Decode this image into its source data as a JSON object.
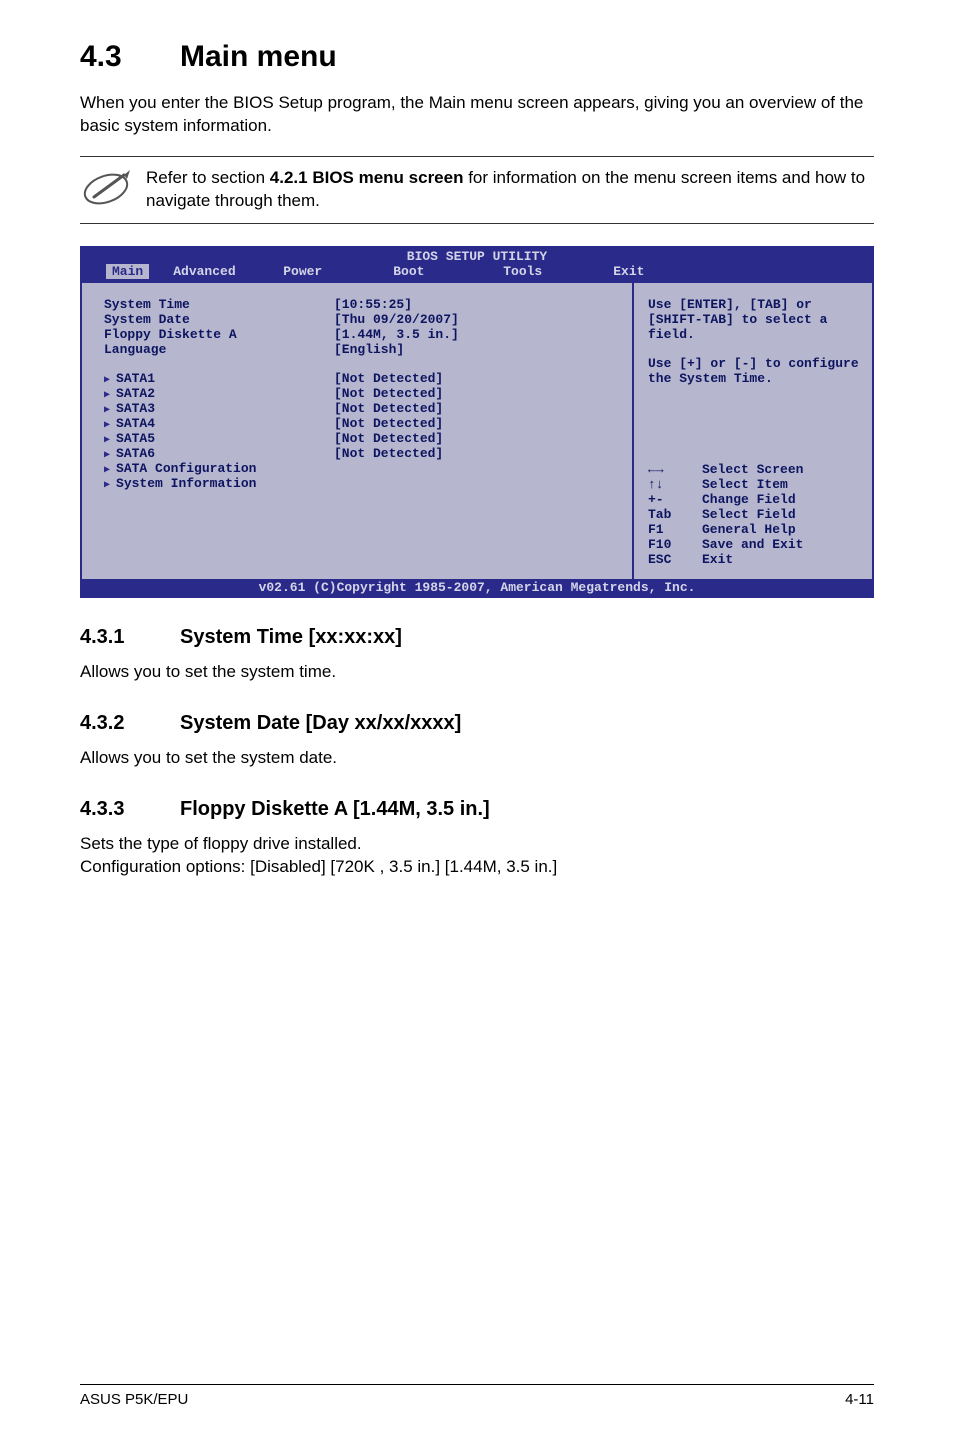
{
  "section": {
    "number": "4.3",
    "title": "Main menu"
  },
  "intro": "When you enter the BIOS Setup program, the Main menu screen appears, giving you an overview of the basic system information.",
  "note": {
    "pre": "Refer to section ",
    "bold": "4.2.1  BIOS menu screen",
    "post": " for information on the menu screen items and how to navigate through them."
  },
  "bios": {
    "header_title": "BIOS SETUP UTILITY",
    "tabs": {
      "active": "Main",
      "rest": [
        "Advanced",
        "Power",
        "Boot",
        "Tools",
        "Exit"
      ]
    },
    "left": {
      "group1": [
        {
          "label": "System Time",
          "value": "[10:55:25]"
        },
        {
          "label": "System Date",
          "value": "[Thu 09/20/2007]"
        },
        {
          "label": "Floppy Diskette A",
          "value": "[1.44M, 3.5 in.]"
        },
        {
          "label": "Language",
          "value": "[English]"
        }
      ],
      "group2": [
        {
          "label": "SATA1",
          "value": "[Not Detected]"
        },
        {
          "label": "SATA2",
          "value": "[Not Detected]"
        },
        {
          "label": "SATA3",
          "value": "[Not Detected]"
        },
        {
          "label": "SATA4",
          "value": "[Not Detected]"
        },
        {
          "label": "SATA5",
          "value": "[Not Detected]"
        },
        {
          "label": "SATA6",
          "value": "[Not Detected]"
        }
      ],
      "group3": [
        {
          "label": "SATA Configuration"
        },
        {
          "label": "System Information"
        }
      ]
    },
    "right": {
      "help1": "Use [ENTER], [TAB] or [SHIFT-TAB] to select a field.",
      "help2": "Use [+] or [-] to configure the System Time.",
      "keys": [
        {
          "k": "←→",
          "d": "Select Screen"
        },
        {
          "k": "↑↓",
          "d": "Select Item"
        },
        {
          "k": "+-",
          "d": "Change Field"
        },
        {
          "k": "Tab",
          "d": "Select Field"
        },
        {
          "k": "F1",
          "d": "General Help"
        },
        {
          "k": "F10",
          "d": "Save and Exit"
        },
        {
          "k": "ESC",
          "d": "Exit"
        }
      ]
    },
    "footer": "v02.61 (C)Copyright 1985-2007, American Megatrends, Inc."
  },
  "subs": [
    {
      "num": "4.3.1",
      "title": "System Time [xx:xx:xx]",
      "body": "Allows you to set the system time."
    },
    {
      "num": "4.3.2",
      "title": "System Date [Day xx/xx/xxxx]",
      "body": "Allows you to set the system date."
    },
    {
      "num": "4.3.3",
      "title": "Floppy Diskette A [1.44M, 3.5 in.]",
      "body": "Sets the type of floppy drive installed.\nConfiguration options: [Disabled] [720K , 3.5 in.] [1.44M, 3.5 in.]"
    }
  ],
  "footer": {
    "left": "ASUS P5K/EPU",
    "right": "4-11"
  }
}
